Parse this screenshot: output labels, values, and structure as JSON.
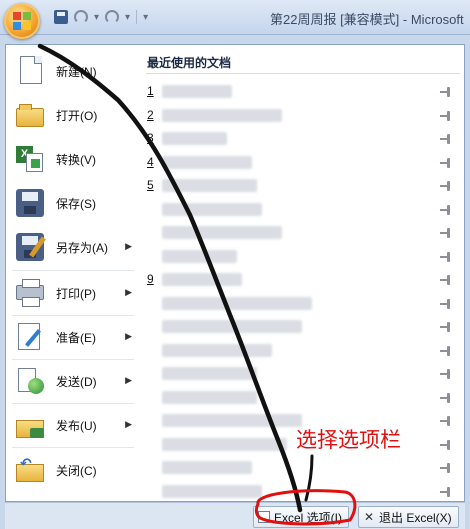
{
  "window": {
    "title": "第22周周报  [兼容模式] - Microsoft"
  },
  "menu": {
    "items": [
      {
        "label": "新建(N)",
        "icon": "new-document-icon",
        "has_submenu": false
      },
      {
        "label": "打开(O)",
        "icon": "open-folder-icon",
        "has_submenu": false
      },
      {
        "label": "转换(V)",
        "icon": "convert-icon",
        "has_submenu": false
      },
      {
        "label": "保存(S)",
        "icon": "save-icon",
        "has_submenu": false
      },
      {
        "label": "另存为(A)",
        "icon": "save-as-icon",
        "has_submenu": true
      },
      {
        "label": "打印(P)",
        "icon": "print-icon",
        "has_submenu": true
      },
      {
        "label": "准备(E)",
        "icon": "prepare-icon",
        "has_submenu": true
      },
      {
        "label": "发送(D)",
        "icon": "send-icon",
        "has_submenu": true
      },
      {
        "label": "发布(U)",
        "icon": "publish-icon",
        "has_submenu": true
      },
      {
        "label": "关闭(C)",
        "icon": "close-document-icon",
        "has_submenu": false
      }
    ]
  },
  "recent": {
    "title": "最近使用的文档",
    "rows": [
      {
        "num": "1"
      },
      {
        "num": "2"
      },
      {
        "num": "3"
      },
      {
        "num": "4"
      },
      {
        "num": "5"
      },
      {
        "num": ""
      },
      {
        "num": ""
      },
      {
        "num": ""
      },
      {
        "num": "9"
      },
      {
        "num": ""
      },
      {
        "num": ""
      },
      {
        "num": ""
      },
      {
        "num": ""
      },
      {
        "num": ""
      },
      {
        "num": ""
      },
      {
        "num": ""
      },
      {
        "num": ""
      },
      {
        "num": ""
      }
    ]
  },
  "bottom": {
    "options_label": "Excel 选项(I)",
    "exit_label": "退出 Excel(X)"
  },
  "annotation": {
    "text": "选择选项栏",
    "color": "#e01010"
  }
}
